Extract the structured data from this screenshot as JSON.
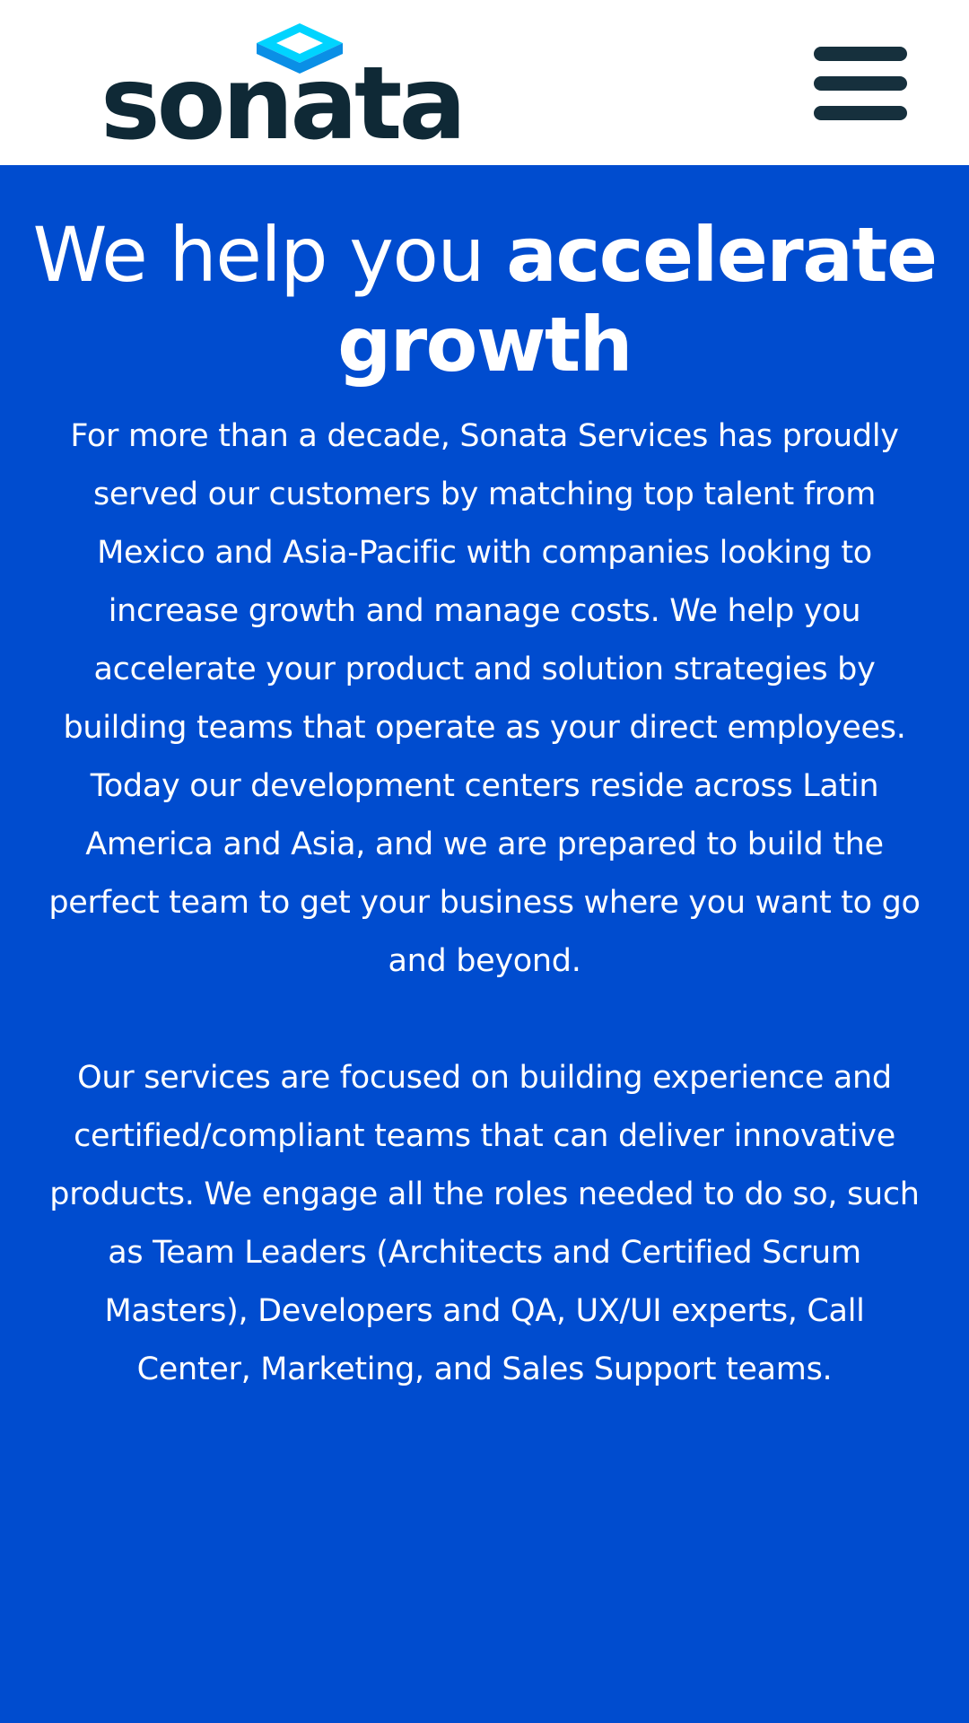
{
  "header": {
    "logo_text": "sonata",
    "menu_icon": "hamburger-menu-icon",
    "background": "#ffffff"
  },
  "hero": {
    "title_regular": "We help you",
    "title_bold": "accelerate growth",
    "paragraphs": [
      "For more than a decade, Sonata Services has proudly served our customers by matching top talent from Mexico and Asia-Pacific with companies looking to increase growth and manage costs. We help you accelerate your product and solution strategies by building teams that operate as your direct employees. Today our development centers reside across Latin America and Asia, and we are prepared to build the perfect team to get your business where you want to go and beyond.",
      "Our services are focused on building experience and certified/compliant teams that can deliver innovative products. We engage all the roles needed to do so, such as Team Leaders (Architects and Certified Scrum Masters), Developers and QA, UX/UI experts, Call Center, Marketing, and Sales Support teams."
    ],
    "background": "#004ccf",
    "text_color": "#ffffff"
  },
  "colors": {
    "logo_dark": "#0f2936",
    "logo_cyan": "#00d4ff",
    "logo_blue": "#0a8fe6",
    "menu_icon": "#16303d"
  }
}
